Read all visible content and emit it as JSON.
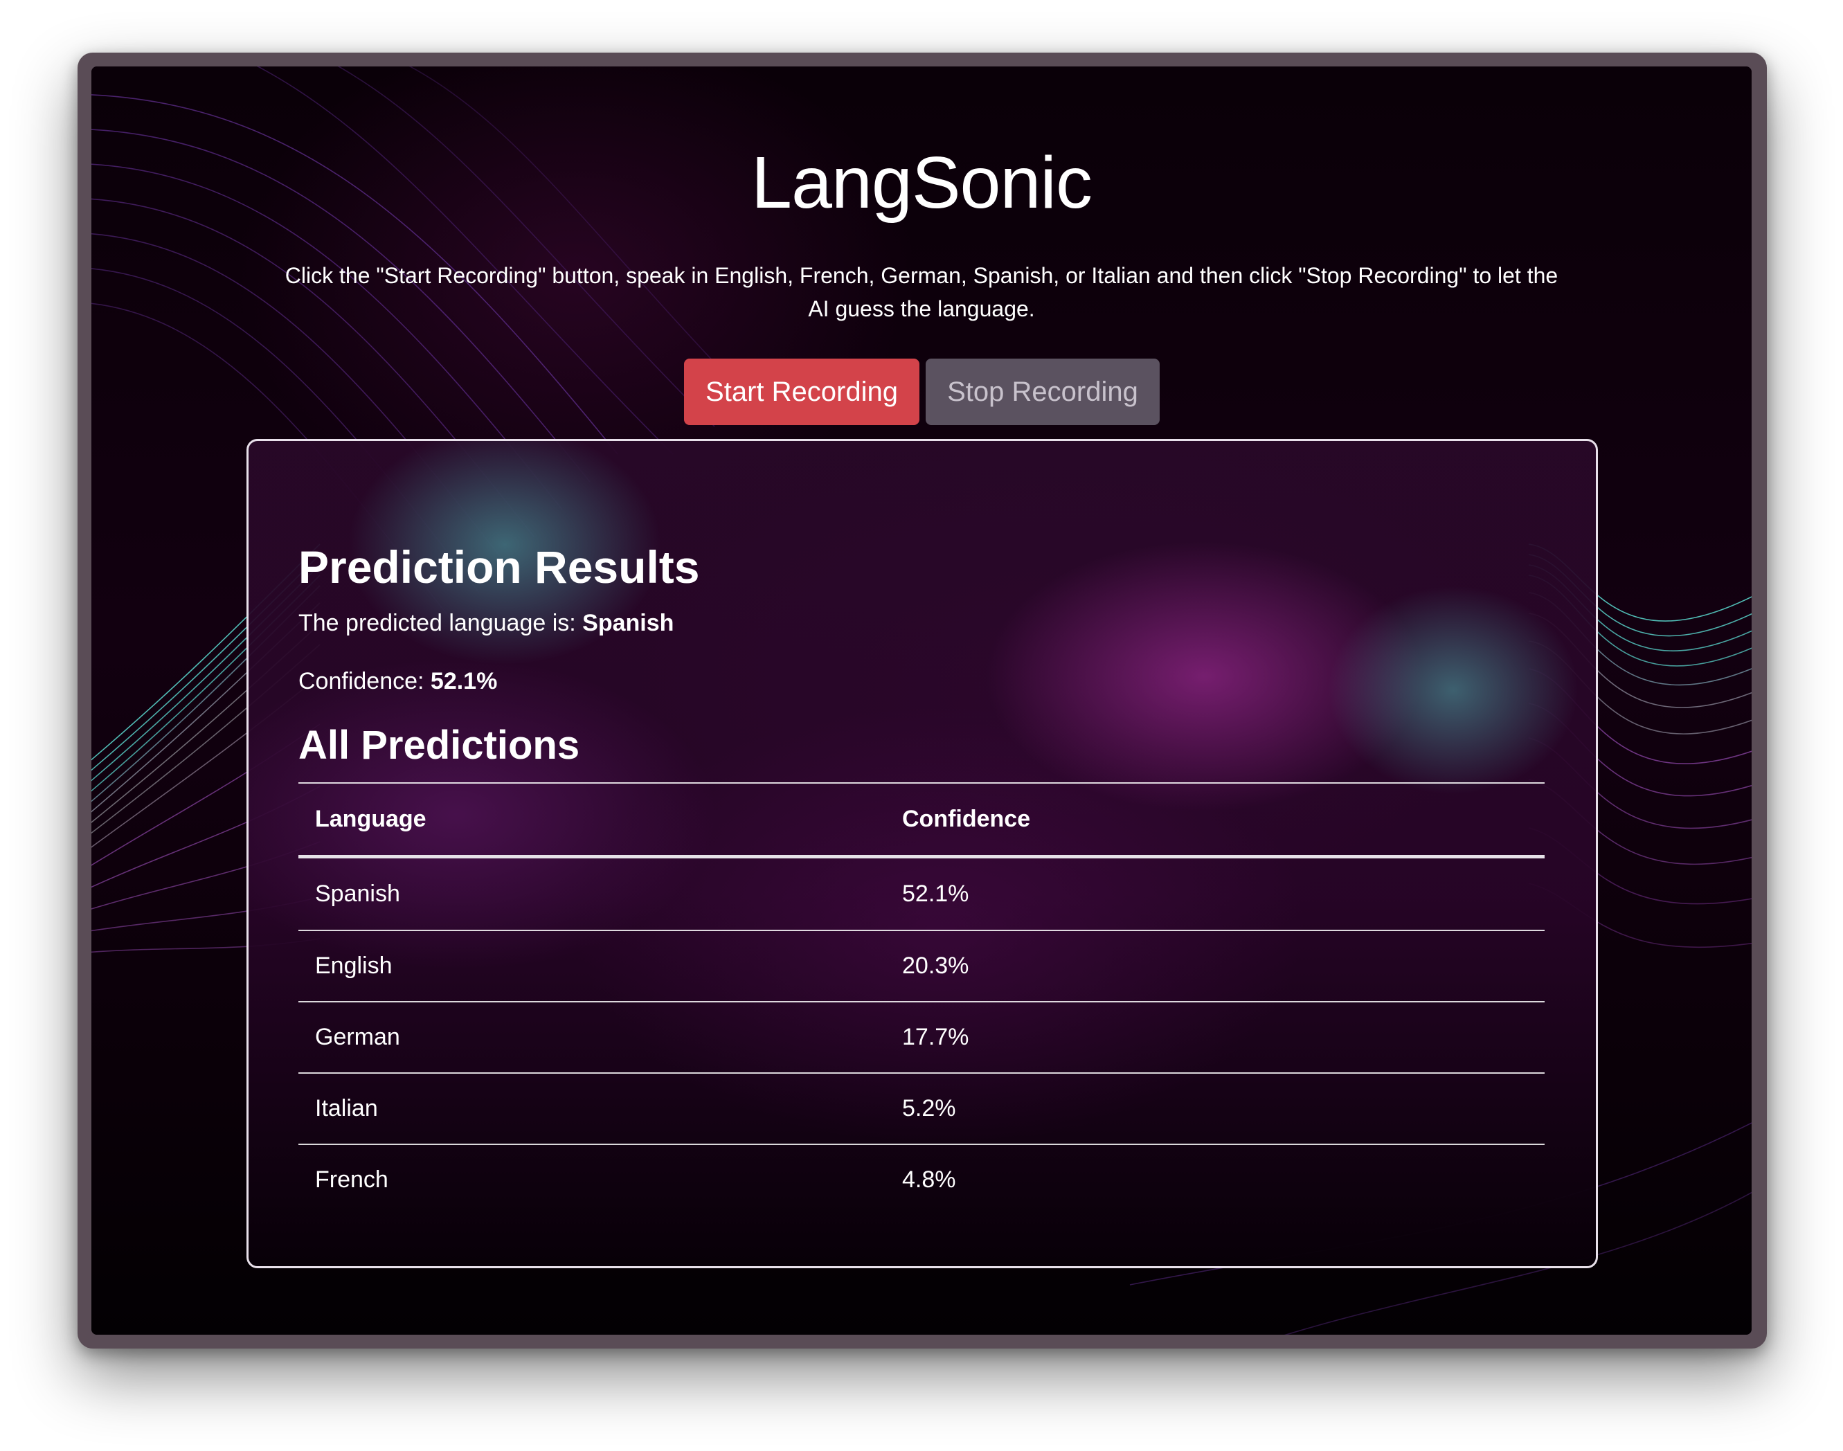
{
  "app": {
    "title": "LangSonic",
    "instructions": "Click the \"Start Recording\" button, speak in English, French, German, Spanish, or Italian and then click \"Stop Recording\" to let the AI guess the language."
  },
  "controls": {
    "start_label": "Start Recording",
    "stop_label": "Stop Recording"
  },
  "results": {
    "title": "Prediction Results",
    "predicted_prefix": "The predicted language is: ",
    "predicted_language": "Spanish",
    "confidence_prefix": "Confidence: ",
    "confidence_value": "52.1%"
  },
  "predictions": {
    "title": "All Predictions",
    "columns": [
      "Language",
      "Confidence"
    ],
    "rows": [
      {
        "language": "Spanish",
        "confidence": "52.1%"
      },
      {
        "language": "English",
        "confidence": "20.3%"
      },
      {
        "language": "German",
        "confidence": "17.7%"
      },
      {
        "language": "Italian",
        "confidence": "5.2%"
      },
      {
        "language": "French",
        "confidence": "4.8%"
      }
    ]
  },
  "colors": {
    "start_button": "#d3434a",
    "stop_button": "#5b5260",
    "background": "#050006",
    "accent_teal": "#5fd4c8",
    "accent_purple": "#a33bd0"
  }
}
